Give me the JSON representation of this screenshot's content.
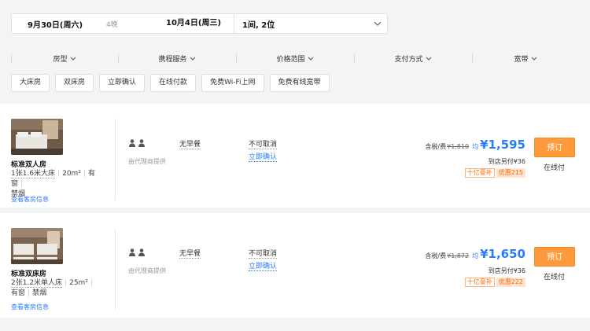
{
  "search": {
    "checkin": "9月30日(周六)",
    "nights": "4晚",
    "checkout": "10月4日(周三)",
    "rooms_guests": "1间, 2位"
  },
  "filters": [
    "房型",
    "携程服务",
    "价格范围",
    "支付方式",
    "宽带"
  ],
  "tags": [
    "大床房",
    "双床房",
    "立即确认",
    "在线付款",
    "免费Wi-Fi上网",
    "免费有线宽带"
  ],
  "rooms": [
    {
      "name": "标准双人房",
      "bed": "1张1.6米大床",
      "area": "20m²",
      "window": "有窗",
      "smoking": "禁烟",
      "info_link": "查看客房信息",
      "supplier": "由代理商提供",
      "meal": "无早餐",
      "cancel": "不可取消",
      "confirm": "立即确认",
      "tax_label": "含税/费",
      "original_price": "¥1,810",
      "avg_label": "均",
      "price": "¥1,595",
      "hotel_pay": "到店另付¥36",
      "badge_subsidy": "十亿豪补",
      "badge_discount": "优惠215",
      "book_label": "预订",
      "pay_type": "在线付"
    },
    {
      "name": "标准双床房",
      "bed": "2张1.2米单人床",
      "area": "25m²",
      "window": "有窗",
      "smoking": "禁烟",
      "info_link": "查看客房信息",
      "supplier": "由代理商提供",
      "meal": "无早餐",
      "cancel": "不可取消",
      "confirm": "立即确认",
      "tax_label": "含税/费",
      "original_price": "¥1,872",
      "avg_label": "均",
      "price": "¥1,650",
      "hotel_pay": "到店另付¥36",
      "badge_subsidy": "十亿豪补",
      "badge_discount": "优惠222",
      "book_label": "预订",
      "pay_type": "在线付"
    }
  ],
  "colors": {
    "accent": "#287dfa",
    "book": "#ff9a3c",
    "promo": "#ff6a00"
  }
}
